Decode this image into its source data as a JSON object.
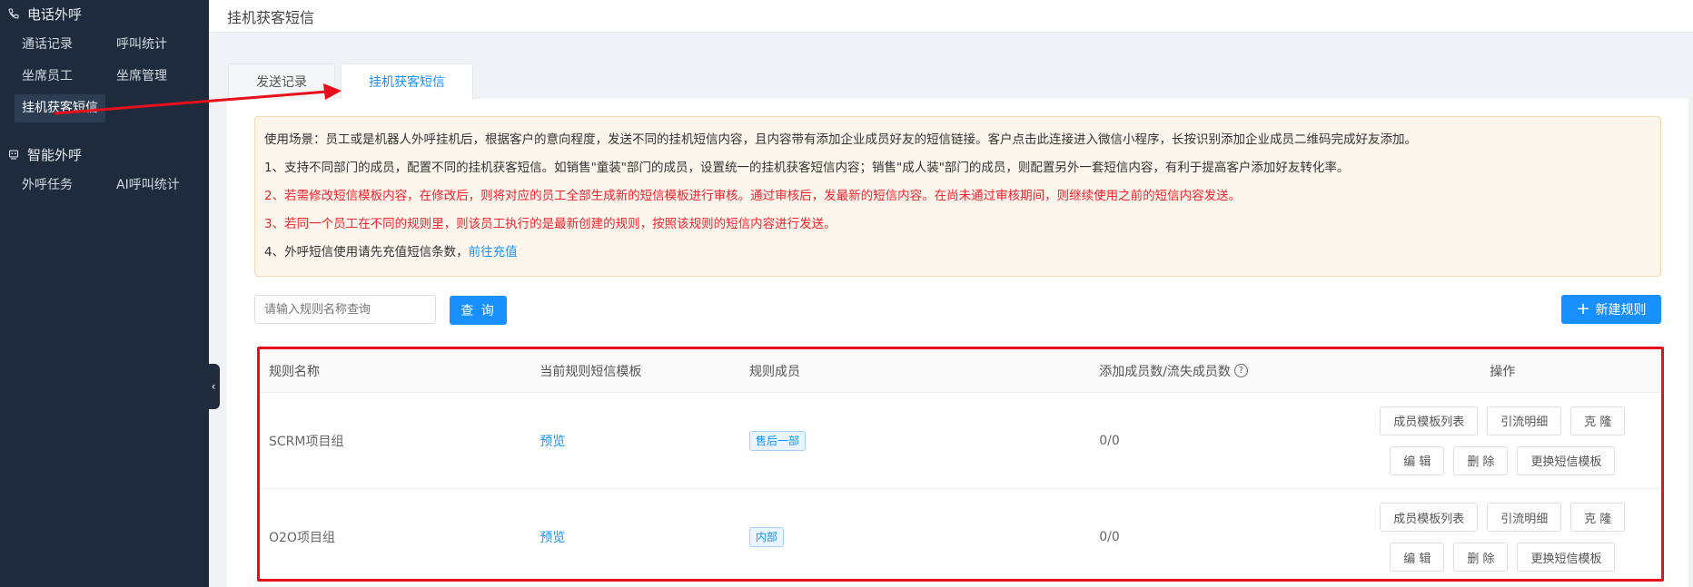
{
  "sidebar": {
    "group1_title": "电话外呼",
    "group1_items": [
      "通话记录",
      "呼叫统计",
      "坐席员工",
      "坐席管理",
      "挂机获客短信"
    ],
    "group2_title": "智能外呼",
    "group2_items": [
      "外呼任务",
      "AI呼叫统计"
    ]
  },
  "header": {
    "title": "挂机获客短信"
  },
  "tabs": [
    {
      "label": "发送记录"
    },
    {
      "label": "挂机获客短信"
    }
  ],
  "notice": {
    "line0": "使用场景：员工或是机器人外呼挂机后，根据客户的意向程度，发送不同的挂机短信内容，且内容带有添加企业成员好友的短信链接。客户点击此连接进入微信小程序，长按识别添加企业成员二维码完成好友添加。",
    "line1": "1、支持不同部门的成员，配置不同的挂机获客短信。如销售\"童装\"部门的成员，设置统一的挂机获客短信内容；销售\"成人装\"部门的成员，则配置另外一套短信内容，有利于提高客户添加好友转化率。",
    "line2": "2、若需修改短信模板内容，在修改后，则将对应的员工全部生成新的短信模板进行审核。通过审核后，发最新的短信内容。在尚未通过审核期间，则继续使用之前的短信内容发送。",
    "line3": "3、若同一个员工在不同的规则里，则该员工执行的是最新创建的规则，按照该规则的短信内容进行发送。",
    "line4_text": "4、外呼短信使用请先充值短信条数，",
    "line4_link": "前往充值"
  },
  "search": {
    "placeholder": "请输入规则名称查询",
    "button": "查 询"
  },
  "new_rule_button": "新建规则",
  "table": {
    "headers": [
      "规则名称",
      "当前规则短信模板",
      "规则成员",
      "添加成员数/流失成员数",
      "操作"
    ],
    "rows": [
      {
        "name": "SCRM项目组",
        "template": "预览",
        "member": "售后一部",
        "count": "0/0"
      },
      {
        "name": "O2O项目组",
        "template": "预览",
        "member": "内部",
        "count": "0/0"
      }
    ],
    "ops": {
      "member_templates": "成员模板列表",
      "traffic_detail": "引流明细",
      "clone": "克 隆",
      "edit": "编 辑",
      "delete": "删 除",
      "change_template": "更换短信模板"
    }
  },
  "colors": {
    "sidebar_bg": "#1e2b3c",
    "primary": "#1890ff",
    "warning_text": "#f5222d",
    "highlight_border": "#e60f1a"
  }
}
